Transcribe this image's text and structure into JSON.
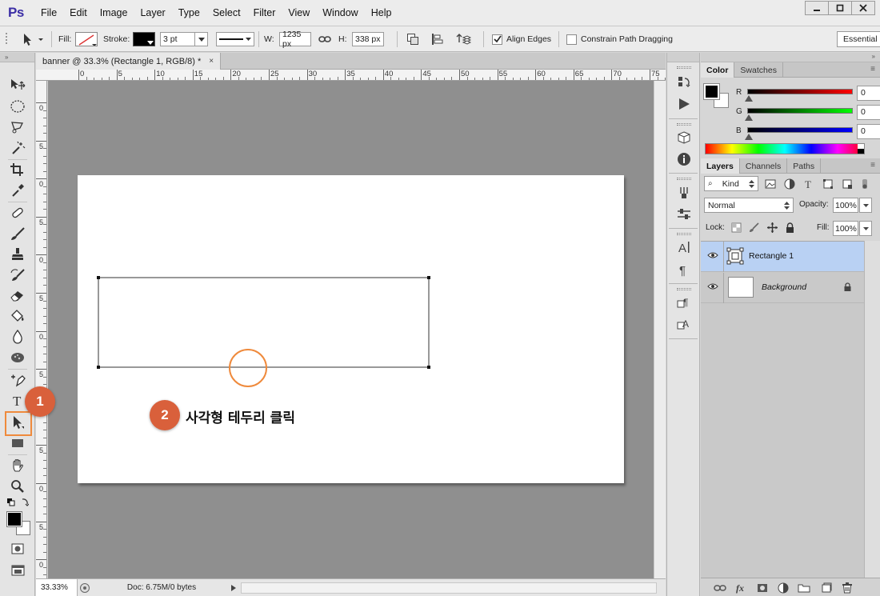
{
  "app": {
    "logo": "Ps"
  },
  "menu": [
    "File",
    "Edit",
    "Image",
    "Layer",
    "Type",
    "Select",
    "Filter",
    "View",
    "Window",
    "Help"
  ],
  "options_bar": {
    "fill_label": "Fill:",
    "stroke_label": "Stroke:",
    "stroke_width": "3 pt",
    "w_label": "W:",
    "w_value": "1235 px",
    "h_label": "H:",
    "h_value": "338 px",
    "align_edges_label": "Align Edges",
    "align_edges_checked": true,
    "constrain_label": "Constrain Path Dragging",
    "constrain_checked": false,
    "workspace": "Essential"
  },
  "document": {
    "tab_title": "banner @ 33.3% (Rectangle 1, RGB/8) *",
    "tab_close": "×",
    "ruler_h": [
      "0",
      "5",
      "10",
      "15",
      "20",
      "25",
      "30",
      "35",
      "40",
      "45",
      "50",
      "55",
      "60",
      "65",
      "70",
      "75"
    ],
    "ruler_v": [
      "0",
      "5",
      "0",
      "5",
      "0",
      "5",
      "0",
      "5",
      "0",
      "5",
      "0",
      "5",
      "0"
    ],
    "zoom": "33.33%",
    "doc_info": "Doc: 6.75M/0 bytes"
  },
  "annotations": {
    "step1": "1",
    "step2": "2",
    "step2_text": "사각형 테두리 클릭",
    "accent_color": "#d9603b",
    "highlight_color": "#ef8a3c"
  },
  "color_panel": {
    "tabs": [
      "Color",
      "Swatches"
    ],
    "r_label": "R",
    "g_label": "G",
    "b_label": "B",
    "r_value": "0",
    "g_value": "0",
    "b_value": "0"
  },
  "layers_panel": {
    "tabs": [
      "Layers",
      "Channels",
      "Paths"
    ],
    "kind": "Kind",
    "blend_mode": "Normal",
    "opacity_label": "Opacity:",
    "opacity_value": "100%",
    "lock_label": "Lock:",
    "fill_label": "Fill:",
    "fill_value": "100%",
    "layers": [
      {
        "name": "Rectangle 1",
        "selected": true,
        "italic": false
      },
      {
        "name": "Background",
        "selected": false,
        "italic": true
      }
    ]
  }
}
